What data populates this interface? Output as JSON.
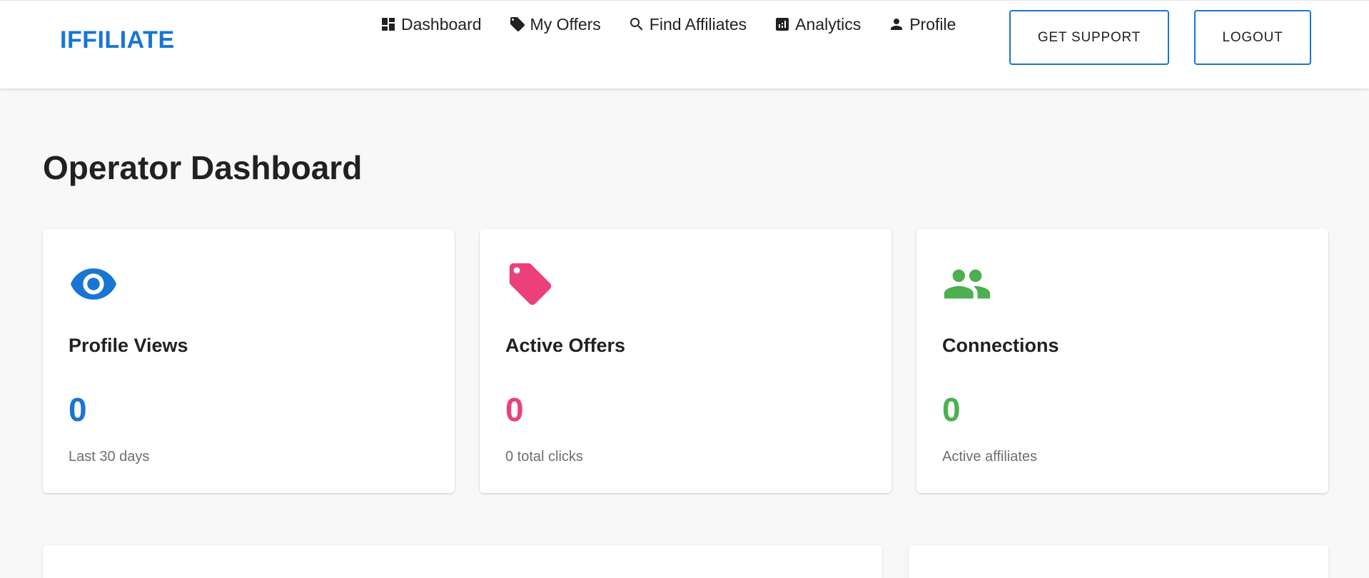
{
  "brand": "IFFILIATE",
  "nav": [
    {
      "label": "Dashboard",
      "icon": "dashboard-icon"
    },
    {
      "label": "My Offers",
      "icon": "tag-icon"
    },
    {
      "label": "Find Affiliates",
      "icon": "search-icon"
    },
    {
      "label": "Analytics",
      "icon": "analytics-icon"
    },
    {
      "label": "Profile",
      "icon": "person-icon"
    }
  ],
  "buttons": {
    "support": "GET SUPPORT",
    "logout": "LOGOUT"
  },
  "page_title": "Operator Dashboard",
  "stats": [
    {
      "title": "Profile Views",
      "value": "0",
      "sub": "Last 30 days",
      "icon": "eye-icon",
      "color": "#1976d2"
    },
    {
      "title": "Active Offers",
      "value": "0",
      "sub": "0 total clicks",
      "icon": "tag-icon",
      "color": "#ec407a"
    },
    {
      "title": "Connections",
      "value": "0",
      "sub": "Active affiliates",
      "icon": "people-icon",
      "color": "#4caf50"
    }
  ],
  "colors": {
    "primary": "#1976d2",
    "pink": "#ec407a",
    "green": "#4caf50",
    "background": "#f8f8f8"
  }
}
